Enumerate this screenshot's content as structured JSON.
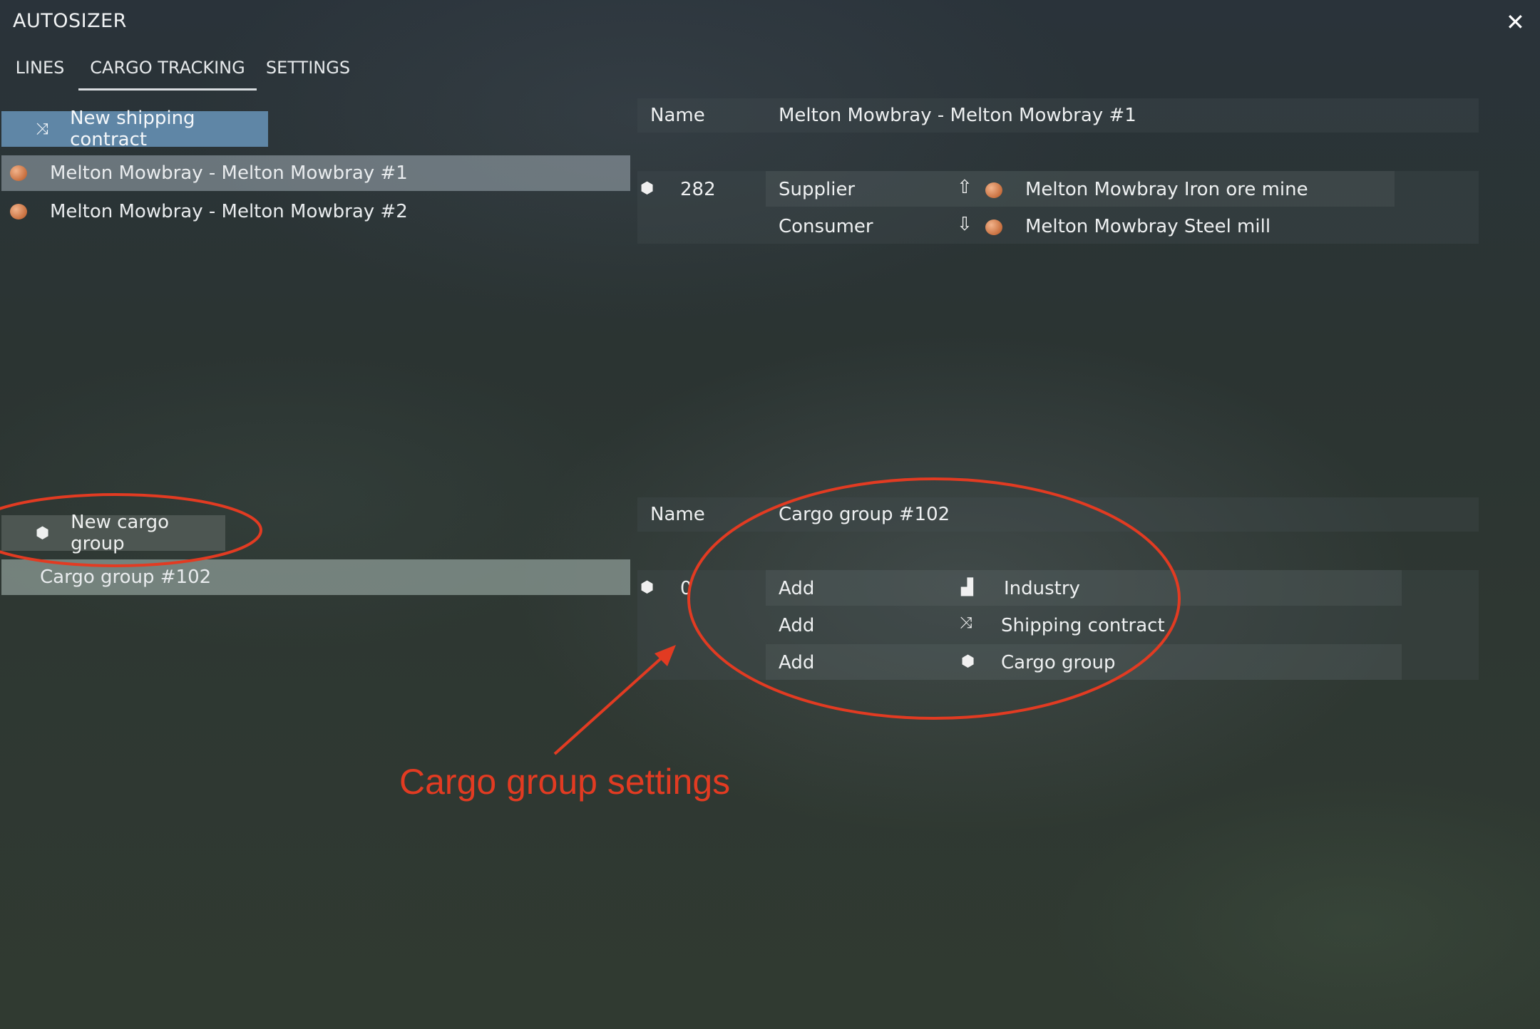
{
  "window": {
    "title": "AUTOSIZER"
  },
  "tabs": [
    {
      "label": "LINES"
    },
    {
      "label": "CARGO TRACKING"
    },
    {
      "label": "SETTINGS"
    }
  ],
  "contracts": {
    "new_button": "New shipping contract",
    "items": [
      {
        "label": "Melton Mowbray - Melton Mowbray #1"
      },
      {
        "label": "Melton Mowbray - Melton Mowbray #2"
      }
    ]
  },
  "contract_detail": {
    "name_label": "Name",
    "name_value": "Melton Mowbray - Melton Mowbray #1",
    "count": "282",
    "supplier_label": "Supplier",
    "supplier_value": "Melton Mowbray Iron ore mine",
    "consumer_label": "Consumer",
    "consumer_value": "Melton Mowbray Steel mill"
  },
  "cargo_groups": {
    "new_button": "New cargo group",
    "items": [
      {
        "label": "Cargo group #102"
      }
    ]
  },
  "group_detail": {
    "name_label": "Name",
    "name_value": "Cargo group #102",
    "count": "0",
    "rows": [
      {
        "action": "Add",
        "target": "Industry"
      },
      {
        "action": "Add",
        "target": "Shipping contract"
      },
      {
        "action": "Add",
        "target": "Cargo group"
      }
    ]
  },
  "annotation": {
    "text": "Cargo group settings",
    "color": "#e23b22"
  },
  "icons": [
    "close-icon",
    "shuffle-icon",
    "cargo-box-icon",
    "upload-icon",
    "download-icon",
    "factory-icon",
    "resource-orb-icon"
  ],
  "colors": {
    "accent_button": "#5f86a6",
    "annotation": "#e23b22"
  }
}
